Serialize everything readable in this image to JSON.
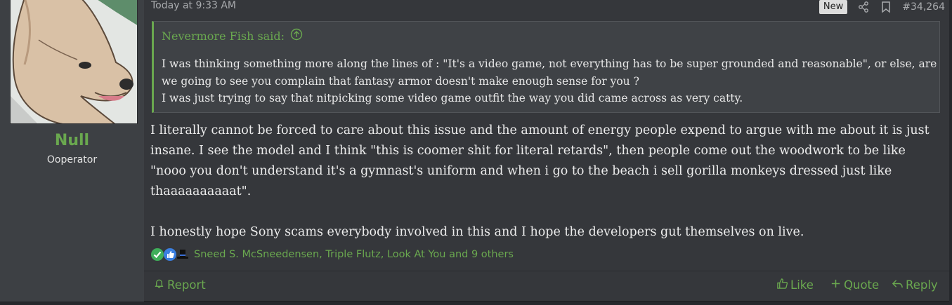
{
  "user": {
    "name": "Null",
    "title": "Ooperator"
  },
  "post": {
    "date": "Today at 9:33 AM",
    "badge_new": "New",
    "number": "#34,264"
  },
  "quote": {
    "author_said": "Nevermore Fish said:",
    "lines": [
      "I was thinking something more along the lines of : \"It's a video game, not everything has to be super grounded and reasonable\", or else, are we going to see you complain that fantasy armor doesn't make enough sense for you ?",
      "I was just trying to say that nitpicking some video game outfit the way you did came across as very catty."
    ]
  },
  "content": {
    "paragraphs": [
      "I literally cannot be forced to care about this issue and the amount of energy people expend to argue with me about it is just insane. I see the model and I think \"this is coomer shit for literal retards\", then people come out the woodwork to be like \"nooo you don't understand it's a gymnast's uniform and when i go to the beach i sell gorilla monkeys dressed just like thaaaaaaaaaat\".",
      "I honestly hope Sony scams everybody involved in this and I hope the developers gut themselves on live."
    ]
  },
  "reactions": {
    "icons": [
      "checkmark-icon",
      "thumbs-up-icon",
      "top-hat-icon"
    ],
    "text": "Sneed S. McSneedensen, Triple Flutz, Look At You and 9 others"
  },
  "footer": {
    "report": "Report",
    "like": "Like",
    "quote": "Quote",
    "reply": "Reply"
  },
  "colors": {
    "accent": "#6aa84f",
    "background": "#35373b",
    "sidebar": "#3d4044"
  }
}
